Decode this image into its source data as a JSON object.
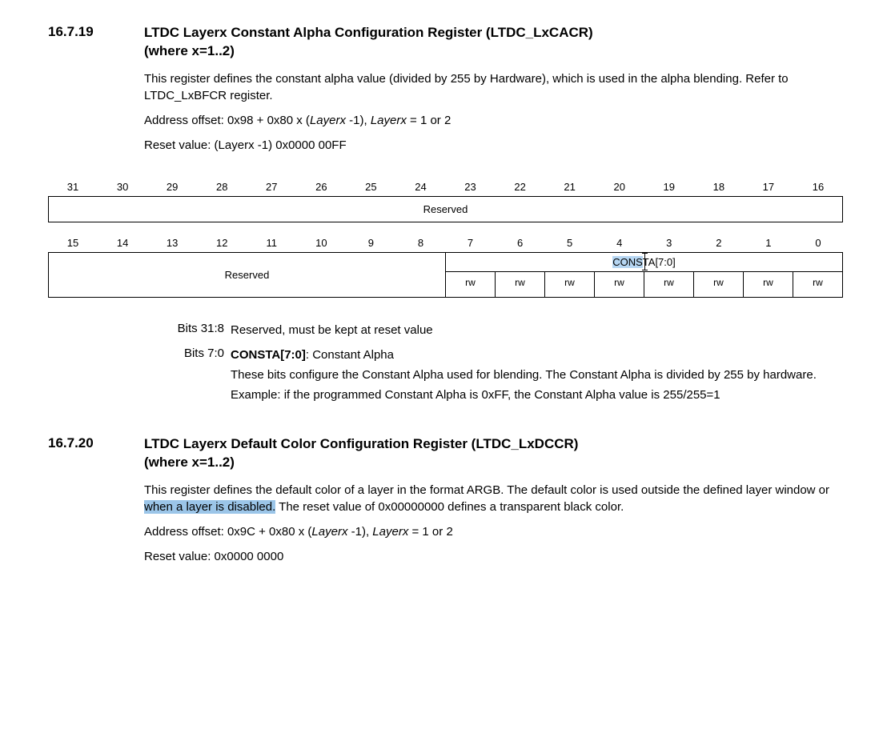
{
  "s1": {
    "number": "16.7.19",
    "title_l1": "LTDC Layerx Constant Alpha Configuration Register (LTDC_LxCACR)",
    "title_l2": "(where x=1..2)",
    "para1": "This register defines the constant alpha value (divided by 255 by Hardware), which is used in the alpha blending. Refer to LTDC_LxBFCR register.",
    "addr_prefix": "Address offset: 0x98 + 0x80 x (",
    "addr_italic1": "Layerx",
    "addr_mid": " -1), ",
    "addr_italic2": "Layerx",
    "addr_suffix": " = 1 or 2",
    "reset": "Reset value: (Layerx -1) 0x0000 00FF"
  },
  "bits_high": [
    "31",
    "30",
    "29",
    "28",
    "27",
    "26",
    "25",
    "24",
    "23",
    "22",
    "21",
    "20",
    "19",
    "18",
    "17",
    "16"
  ],
  "bits_low": [
    "15",
    "14",
    "13",
    "12",
    "11",
    "10",
    "9",
    "8",
    "7",
    "6",
    "5",
    "4",
    "3",
    "2",
    "1",
    "0"
  ],
  "reserved": "Reserved",
  "consta_hl": "CONS",
  "consta_rest": "TA[7:0]",
  "rw": "rw",
  "bd": {
    "r1_label": "Bits 31:8",
    "r1_text": "Reserved, must be kept at reset value",
    "r2_label": "Bits 7:0",
    "r2_bold": "CONSTA[7:0]",
    "r2_rest": ": Constant Alpha",
    "r2_sub1": "These bits configure the Constant Alpha used for blending. The Constant Alpha is divided by 255 by hardware.",
    "r2_sub2": "Example: if the programmed Constant Alpha is 0xFF, the Constant Alpha value is 255/255=1"
  },
  "s2": {
    "number": "16.7.20",
    "title_l1": "LTDC Layerx Default Color Configuration Register (LTDC_LxDCCR)",
    "title_l2": "(where x=1..2)",
    "p_pre": "This register defines the default color of a layer in the format ARGB. The default color is used outside the defined layer window or",
    "p_sel": " when a layer is disabled.",
    "p_post": " The reset value of 0x00000000 defines a transparent black color.",
    "addr_prefix": "Address offset: 0x9C + 0x80 x (",
    "addr_italic1": "Layerx",
    "addr_mid": " -1), ",
    "addr_italic2": "Layerx",
    "addr_suffix": " = 1 or 2",
    "reset": "Reset value: 0x0000 0000"
  }
}
